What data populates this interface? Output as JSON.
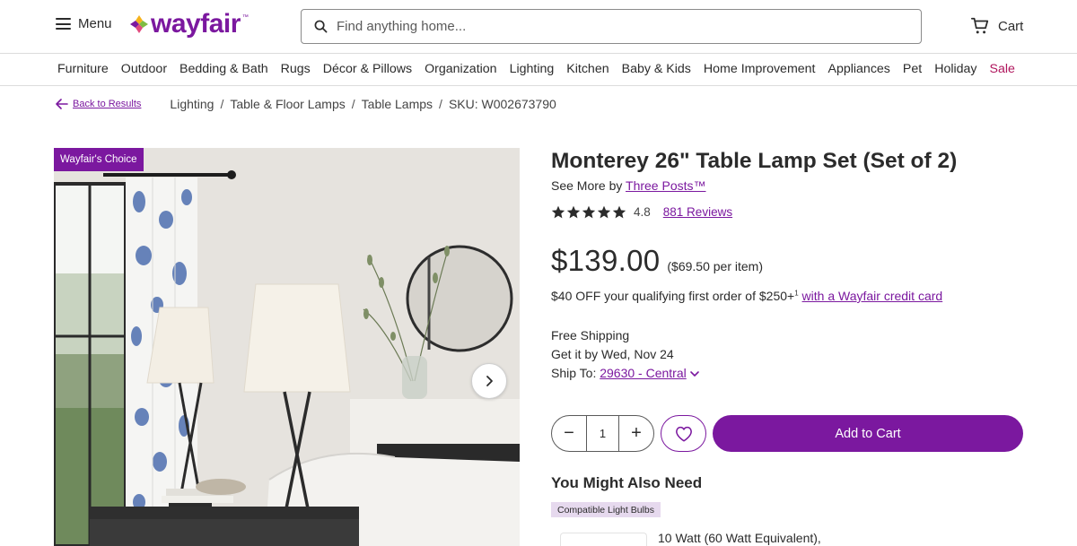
{
  "header": {
    "menu_label": "Menu",
    "logo_text": "wayfair",
    "logo_tm": "™",
    "search_placeholder": "Find anything home...",
    "cart_label": "Cart"
  },
  "categories": [
    "Furniture",
    "Outdoor",
    "Bedding & Bath",
    "Rugs",
    "Décor & Pillows",
    "Organization",
    "Lighting",
    "Kitchen",
    "Baby & Kids",
    "Home Improvement",
    "Appliances",
    "Pet",
    "Holiday",
    "Sale"
  ],
  "breadcrumb": {
    "back_label": "Back to Results",
    "items": [
      "Lighting",
      "Table & Floor Lamps",
      "Table Lamps"
    ],
    "sep": "/",
    "sku": "SKU: W002673790"
  },
  "gallery": {
    "badge": "Wayfair's Choice"
  },
  "product": {
    "title": "Monterey 26\" Table Lamp Set (Set of 2)",
    "see_more_prefix": "See More by",
    "brand": "Three Posts™",
    "rating": "4.8",
    "rating_stars": 4.8,
    "reviews": "881 Reviews",
    "price": "$139.00",
    "per_item": "($69.50 per item)",
    "promo_text": "$40 OFF your qualifying first order of $250+",
    "promo_sup": "1",
    "promo_link": "with a Wayfair credit card",
    "free_shipping": "Free Shipping",
    "delivery": "Get it by Wed, Nov 24",
    "ship_to_label": "Ship To:",
    "ship_to_location": "29630 - Central"
  },
  "actions": {
    "quantity": "1",
    "minus": "−",
    "plus": "+",
    "add_to_cart": "Add to Cart"
  },
  "recommendations": {
    "heading": "You Might Also Need",
    "tag": "Compatible Light Bulbs",
    "first_item": "10 Watt (60 Watt Equivalent),"
  },
  "colors": {
    "brand_purple": "#7b189f",
    "sale_red": "#b0165d",
    "text": "#2b2b2b"
  }
}
